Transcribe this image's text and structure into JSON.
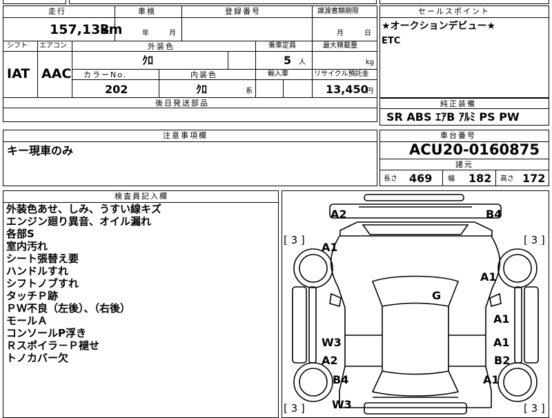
{
  "header": {
    "mileage_label": "走行",
    "mileage_value": "157,133",
    "mileage_unit": "km",
    "inspection_label": "車検",
    "year_unit": "年",
    "month_unit": "月",
    "registration_label": "登録番号",
    "transfer_label": "譲渡書類期限",
    "day_unit": "日"
  },
  "specs": {
    "shift_label": "シフト",
    "shift_value": "IAT",
    "ac_label": "エアコン",
    "ac_value": "AAC",
    "exterior_label": "外装色",
    "exterior_value": "ｸﾛ",
    "color_no_label": "カラーNo.",
    "color_no_value": "202",
    "interior_label": "内装色",
    "interior_value": "ｸﾛ",
    "interior_suffix": "系",
    "capacity_label": "乗車定員",
    "capacity_value": "5",
    "capacity_unit": "人",
    "max_load_label": "最大積載量",
    "max_load_unit": "kg",
    "import_label": "輸入車",
    "recycle_label": "リサイクル預託金",
    "recycle_value": "13,450",
    "recycle_unit": "円",
    "later_parts_label": "後日発送部品"
  },
  "sales": {
    "label": "セールスポイント",
    "line1": "★オークションデビュー★",
    "line2": "ETC"
  },
  "equipment": {
    "label": "純正装備",
    "value": "SR ABS ｴｱB ｱﾙﾐ PS PW"
  },
  "caution": {
    "label": "注意事項欄",
    "value": "キー現車のみ"
  },
  "chassis": {
    "label": "車台番号",
    "value": "ACU20-0160875",
    "dims_label": "諸元",
    "length_label": "長さ",
    "length_value": "469",
    "width_label": "幅",
    "width_value": "182",
    "height_label": "高さ",
    "height_value": "172"
  },
  "inspector": {
    "label": "検査員記入欄",
    "notes": [
      "外装色あせ、しみ、うすい線キズ",
      "エンジン廻り異音、オイル漏れ",
      "各部S",
      "室内汚れ",
      "シート張替え要",
      "ハンドルすれ",
      "シフトノブすれ",
      "タッチＰ跡",
      "ＰＷ不良（左後）、（右後）",
      "モールＡ",
      "コンソールP浮き",
      "Ｒスポイラ－Ｐ褪せ",
      "トノカバー欠"
    ]
  },
  "diagram": {
    "tire_fl": "[ 3 ]",
    "tire_fr": "[ 3 ]",
    "tire_rl": "[ 3 ]",
    "tire_rr": "[ 3 ]",
    "marks": {
      "front_left_bumper": "A2",
      "front_right_bumper": "B4",
      "left_fender": "A1",
      "right_fender": "A1",
      "windshield": "G",
      "right_front_door": "A1",
      "left_rear_door_1": "W3",
      "right_rear_door_1": "A1",
      "left_rear_door_2": "A2",
      "right_rear_door_2": "B2",
      "left_quarter": "B4",
      "right_quarter": "A1",
      "rear": "W3"
    }
  }
}
